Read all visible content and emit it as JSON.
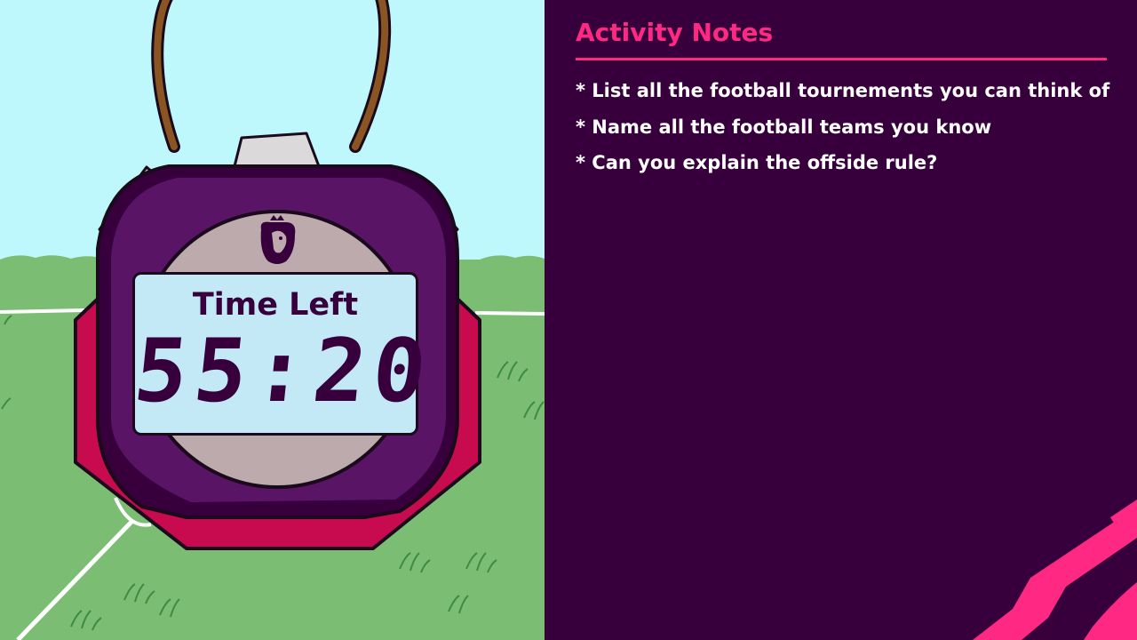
{
  "timer": {
    "label": "Time Left",
    "time": "55:20"
  },
  "notes": {
    "title": "Activity Notes",
    "items": [
      "* List all the football tournements you can think of",
      "* Name all the football teams you know",
      "* Can you explain the offside rule?"
    ]
  },
  "colors": {
    "brand_purple": "#37003c",
    "accent_pink": "#ff2882",
    "stopwatch_red": "#c80a4f",
    "stopwatch_purple": "#5a1466",
    "sky": "#bff8fc",
    "grass": "#7bbd72",
    "lcd": "#c3e9f7"
  },
  "icons": [
    "premier-league-lion-icon",
    "stopwatch-illustration",
    "corner-stripes-decoration"
  ]
}
